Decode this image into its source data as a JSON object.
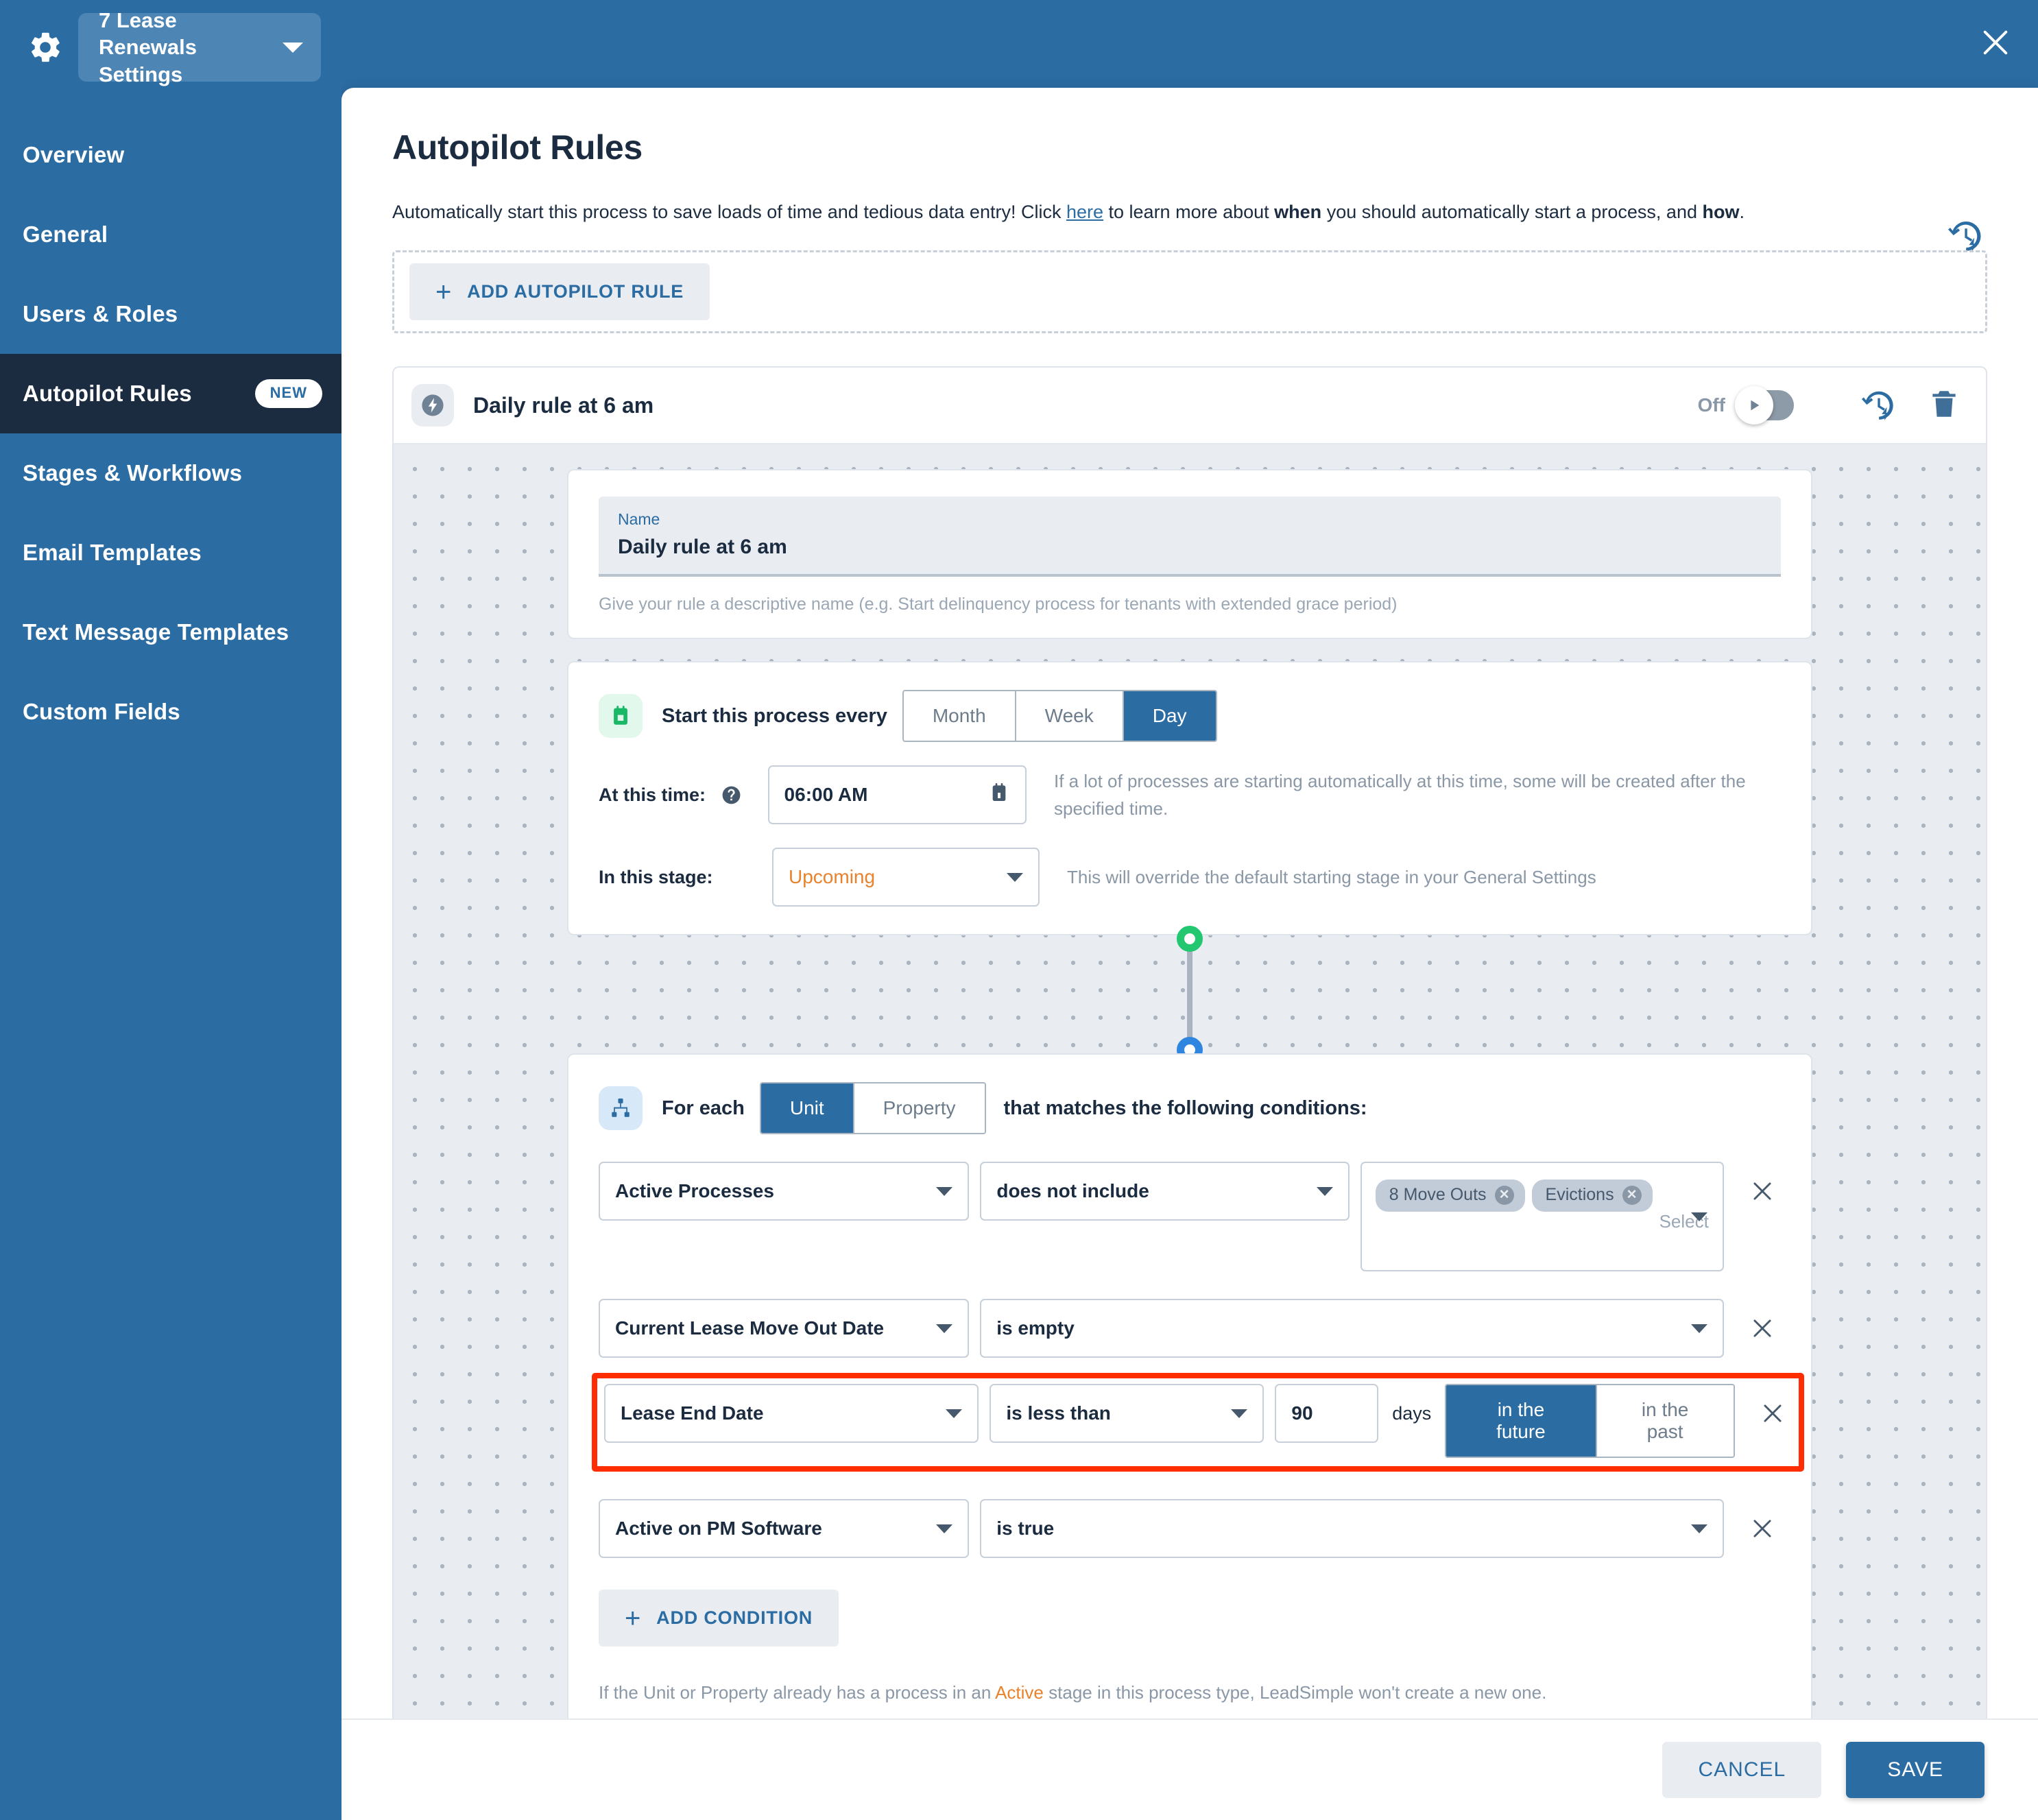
{
  "theme": {
    "brand_blue": "#2b6ca3",
    "sidebar_active": "#1b2b40",
    "accent_orange": "#e8822c",
    "highlight_red": "#ff2d00",
    "green": "#22c770"
  },
  "sidebar": {
    "org_selector": {
      "label": "7 Lease Renewals Settings",
      "icon": "gear-icon",
      "caret": "chevron-down-icon"
    },
    "items": [
      {
        "label": "Overview",
        "active": false,
        "badge": ""
      },
      {
        "label": "General",
        "active": false,
        "badge": ""
      },
      {
        "label": "Users & Roles",
        "active": false,
        "badge": ""
      },
      {
        "label": "Autopilot Rules",
        "active": true,
        "badge": "NEW"
      },
      {
        "label": "Stages & Workflows",
        "active": false,
        "badge": ""
      },
      {
        "label": "Email Templates",
        "active": false,
        "badge": ""
      },
      {
        "label": "Text Message Templates",
        "active": false,
        "badge": ""
      },
      {
        "label": "Custom Fields",
        "active": false,
        "badge": ""
      }
    ]
  },
  "window": {
    "close_icon": "close-icon"
  },
  "page": {
    "title": "Autopilot Rules",
    "history_icon": "history-bolt-icon",
    "desc_part1": "Automatically start this process to save loads of time and tedious data entry! Click ",
    "desc_link": "here",
    "desc_part2": " to learn more about ",
    "desc_bold1": "when",
    "desc_part3": " you should automatically start a process, and ",
    "desc_bold2": "how",
    "desc_part4": ".",
    "add_rule_label": "ADD AUTOPILOT RULE"
  },
  "rule": {
    "icon": "bolt-icon",
    "title": "Daily rule at 6 am",
    "toggle_state_label": "Off",
    "toggle_on": false,
    "history_icon": "history-bolt-icon",
    "delete_icon": "trash-icon",
    "name_field": {
      "label": "Name",
      "value": "Daily rule at 6 am",
      "help": "Give your rule a descriptive name (e.g. Start delinquency process for tenants with extended grace period)"
    },
    "schedule": {
      "icon": "calendar-icon",
      "prefix": "Start this process every",
      "frequency_options": [
        "Month",
        "Week",
        "Day"
      ],
      "frequency_selected": "Day",
      "time_label": "At this time:",
      "time_help_icon": "help-circle-icon",
      "time_value": "06:00 AM",
      "time_picker_icon": "calendar-picker-icon",
      "time_help": "If a lot of processes are starting automatically at this time, some will be created after the specified time.",
      "stage_label": "In this stage:",
      "stage_value": "Upcoming",
      "stage_help": "This will override the default starting stage in your General Settings"
    },
    "conditions_block": {
      "icon": "org-tree-icon",
      "prefix": "For each",
      "entity_options": [
        "Unit",
        "Property"
      ],
      "entity_selected": "Unit",
      "suffix": "that matches the following conditions:",
      "rows": [
        {
          "field": "Active Processes",
          "operator": "does not include",
          "value_type": "multiselect",
          "tags": [
            "8 Move Outs",
            "Evictions"
          ],
          "placeholder": "Select",
          "highlighted": false
        },
        {
          "field": "Current Lease Move Out Date",
          "operator": "is empty",
          "value_type": "none",
          "highlighted": false
        },
        {
          "field": "Lease End Date",
          "operator": "is less than",
          "value_type": "days",
          "number": "90",
          "days_label": "days",
          "direction_options": [
            "in the future",
            "in the past"
          ],
          "direction_selected": "in the future",
          "highlighted": true
        },
        {
          "field": "Active on PM Software",
          "operator": "is true",
          "value_type": "none",
          "highlighted": false
        }
      ],
      "add_condition_label": "ADD CONDITION",
      "note_part1": "If the Unit or Property already has a process in an ",
      "note_highlight": "Active",
      "note_part2": " stage in this process type, LeadSimple won't create a new one."
    }
  },
  "footer": {
    "cancel_label": "CANCEL",
    "save_label": "SAVE"
  }
}
